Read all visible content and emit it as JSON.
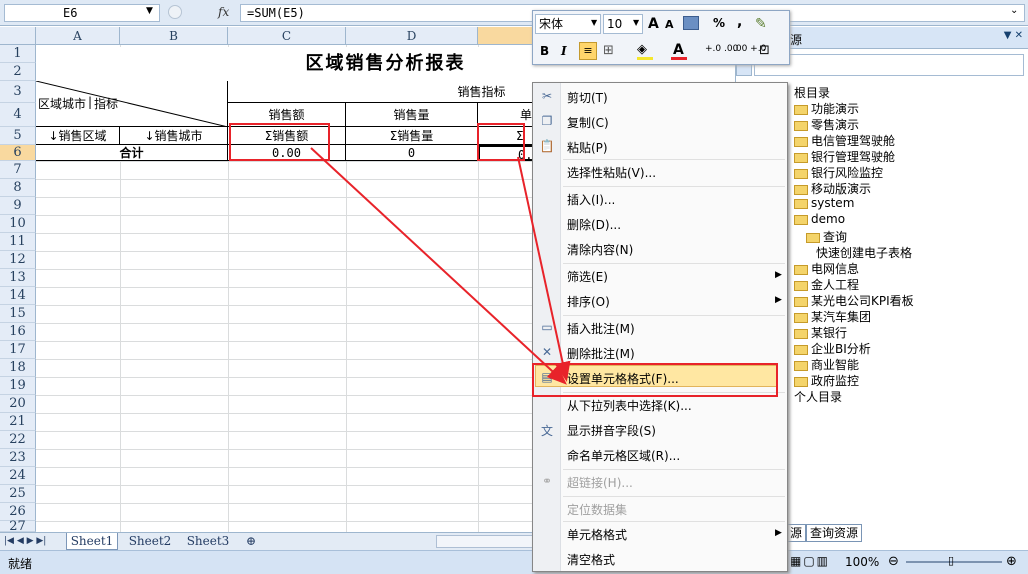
{
  "formula_bar": {
    "cell_ref": "E6",
    "fx": "fx",
    "formula": "=SUM(E5)"
  },
  "columns": [
    "A",
    "B",
    "C",
    "D",
    "E"
  ],
  "rows": [
    "1",
    "2",
    "3",
    "4",
    "5",
    "6",
    "7",
    "8",
    "9",
    "10",
    "11",
    "12",
    "13",
    "14",
    "15",
    "16",
    "17",
    "18",
    "19",
    "20",
    "21",
    "22",
    "23",
    "24",
    "25",
    "26",
    "27"
  ],
  "sheet": {
    "title": "区域销售分析报表",
    "corner_top": "区域城市",
    "corner_sep": "|",
    "corner_bottom": "指标",
    "group_header": "销售指标",
    "headers": [
      "销售额",
      "销售量",
      "单"
    ],
    "row5": [
      "↓销售区域",
      "↓销售城市",
      "Σ销售额",
      "Σ销售量",
      "Σ"
    ],
    "row6": [
      "合计",
      "0.00",
      "0",
      "0."
    ]
  },
  "sheet_tabs": [
    "Sheet1",
    "Sheet2",
    "Sheet3"
  ],
  "status": {
    "ready": "就绪",
    "zoom": "100%"
  },
  "mini_toolbar": {
    "font": "宋体",
    "size": "10",
    "bold": "B",
    "italic": "I",
    "percent": "%",
    "comma": ",",
    "grow": "A",
    "shrink": "A",
    "font_color": "A",
    "inc_decimal": "+.0 .00",
    "dec_decimal": ".00 +.0"
  },
  "panel": {
    "title": "源",
    "root": "根目录",
    "items": [
      "功能演示",
      "零售演示",
      "电信管理驾驶舱",
      "银行管理驾驶舱",
      "银行风险监控",
      "移动版演示",
      "system",
      "demo"
    ],
    "demo_children": [
      "查询",
      "快速创建电子表格"
    ],
    "items2": [
      "电网信息",
      "金人工程",
      "某光电公司KPI看板",
      "某汽车集团",
      "某银行",
      "企业BI分析",
      "商业智能",
      "政府监控"
    ],
    "personal": "个人目录",
    "tabs": [
      "源",
      "查询资源"
    ]
  },
  "context_menu": [
    {
      "label": "剪切(T)",
      "icon": "scissors-icon"
    },
    {
      "label": "复制(C)",
      "icon": "copy-icon"
    },
    {
      "label": "粘贴(P)",
      "icon": "paste-icon"
    },
    {
      "label": "选择性粘贴(V)..."
    },
    {
      "label": "插入(I)..."
    },
    {
      "label": "删除(D)..."
    },
    {
      "label": "清除内容(N)"
    },
    {
      "label": "筛选(E)",
      "submenu": true
    },
    {
      "label": "排序(O)",
      "submenu": true
    },
    {
      "label": "插入批注(M)",
      "icon": "insert-comment-icon"
    },
    {
      "label": "删除批注(M)",
      "icon": "delete-comment-icon"
    },
    {
      "label": "设置单元格格式(F)...",
      "icon": "format-cells-icon",
      "highlighted": true
    },
    {
      "label": "从下拉列表中选择(K)..."
    },
    {
      "label": "显示拼音字段(S)",
      "icon": "phonetic-icon"
    },
    {
      "label": "命名单元格区域(R)..."
    },
    {
      "label": "超链接(H)...",
      "icon": "hyperlink-icon",
      "disabled": true
    },
    {
      "label": "定位数据集",
      "disabled": true
    },
    {
      "label": "单元格格式",
      "submenu": true
    },
    {
      "label": "清空格式"
    }
  ],
  "colors": {
    "accent": "#f9d99f",
    "highlight": "#ffe7a2",
    "annotation": "#e8232a"
  }
}
